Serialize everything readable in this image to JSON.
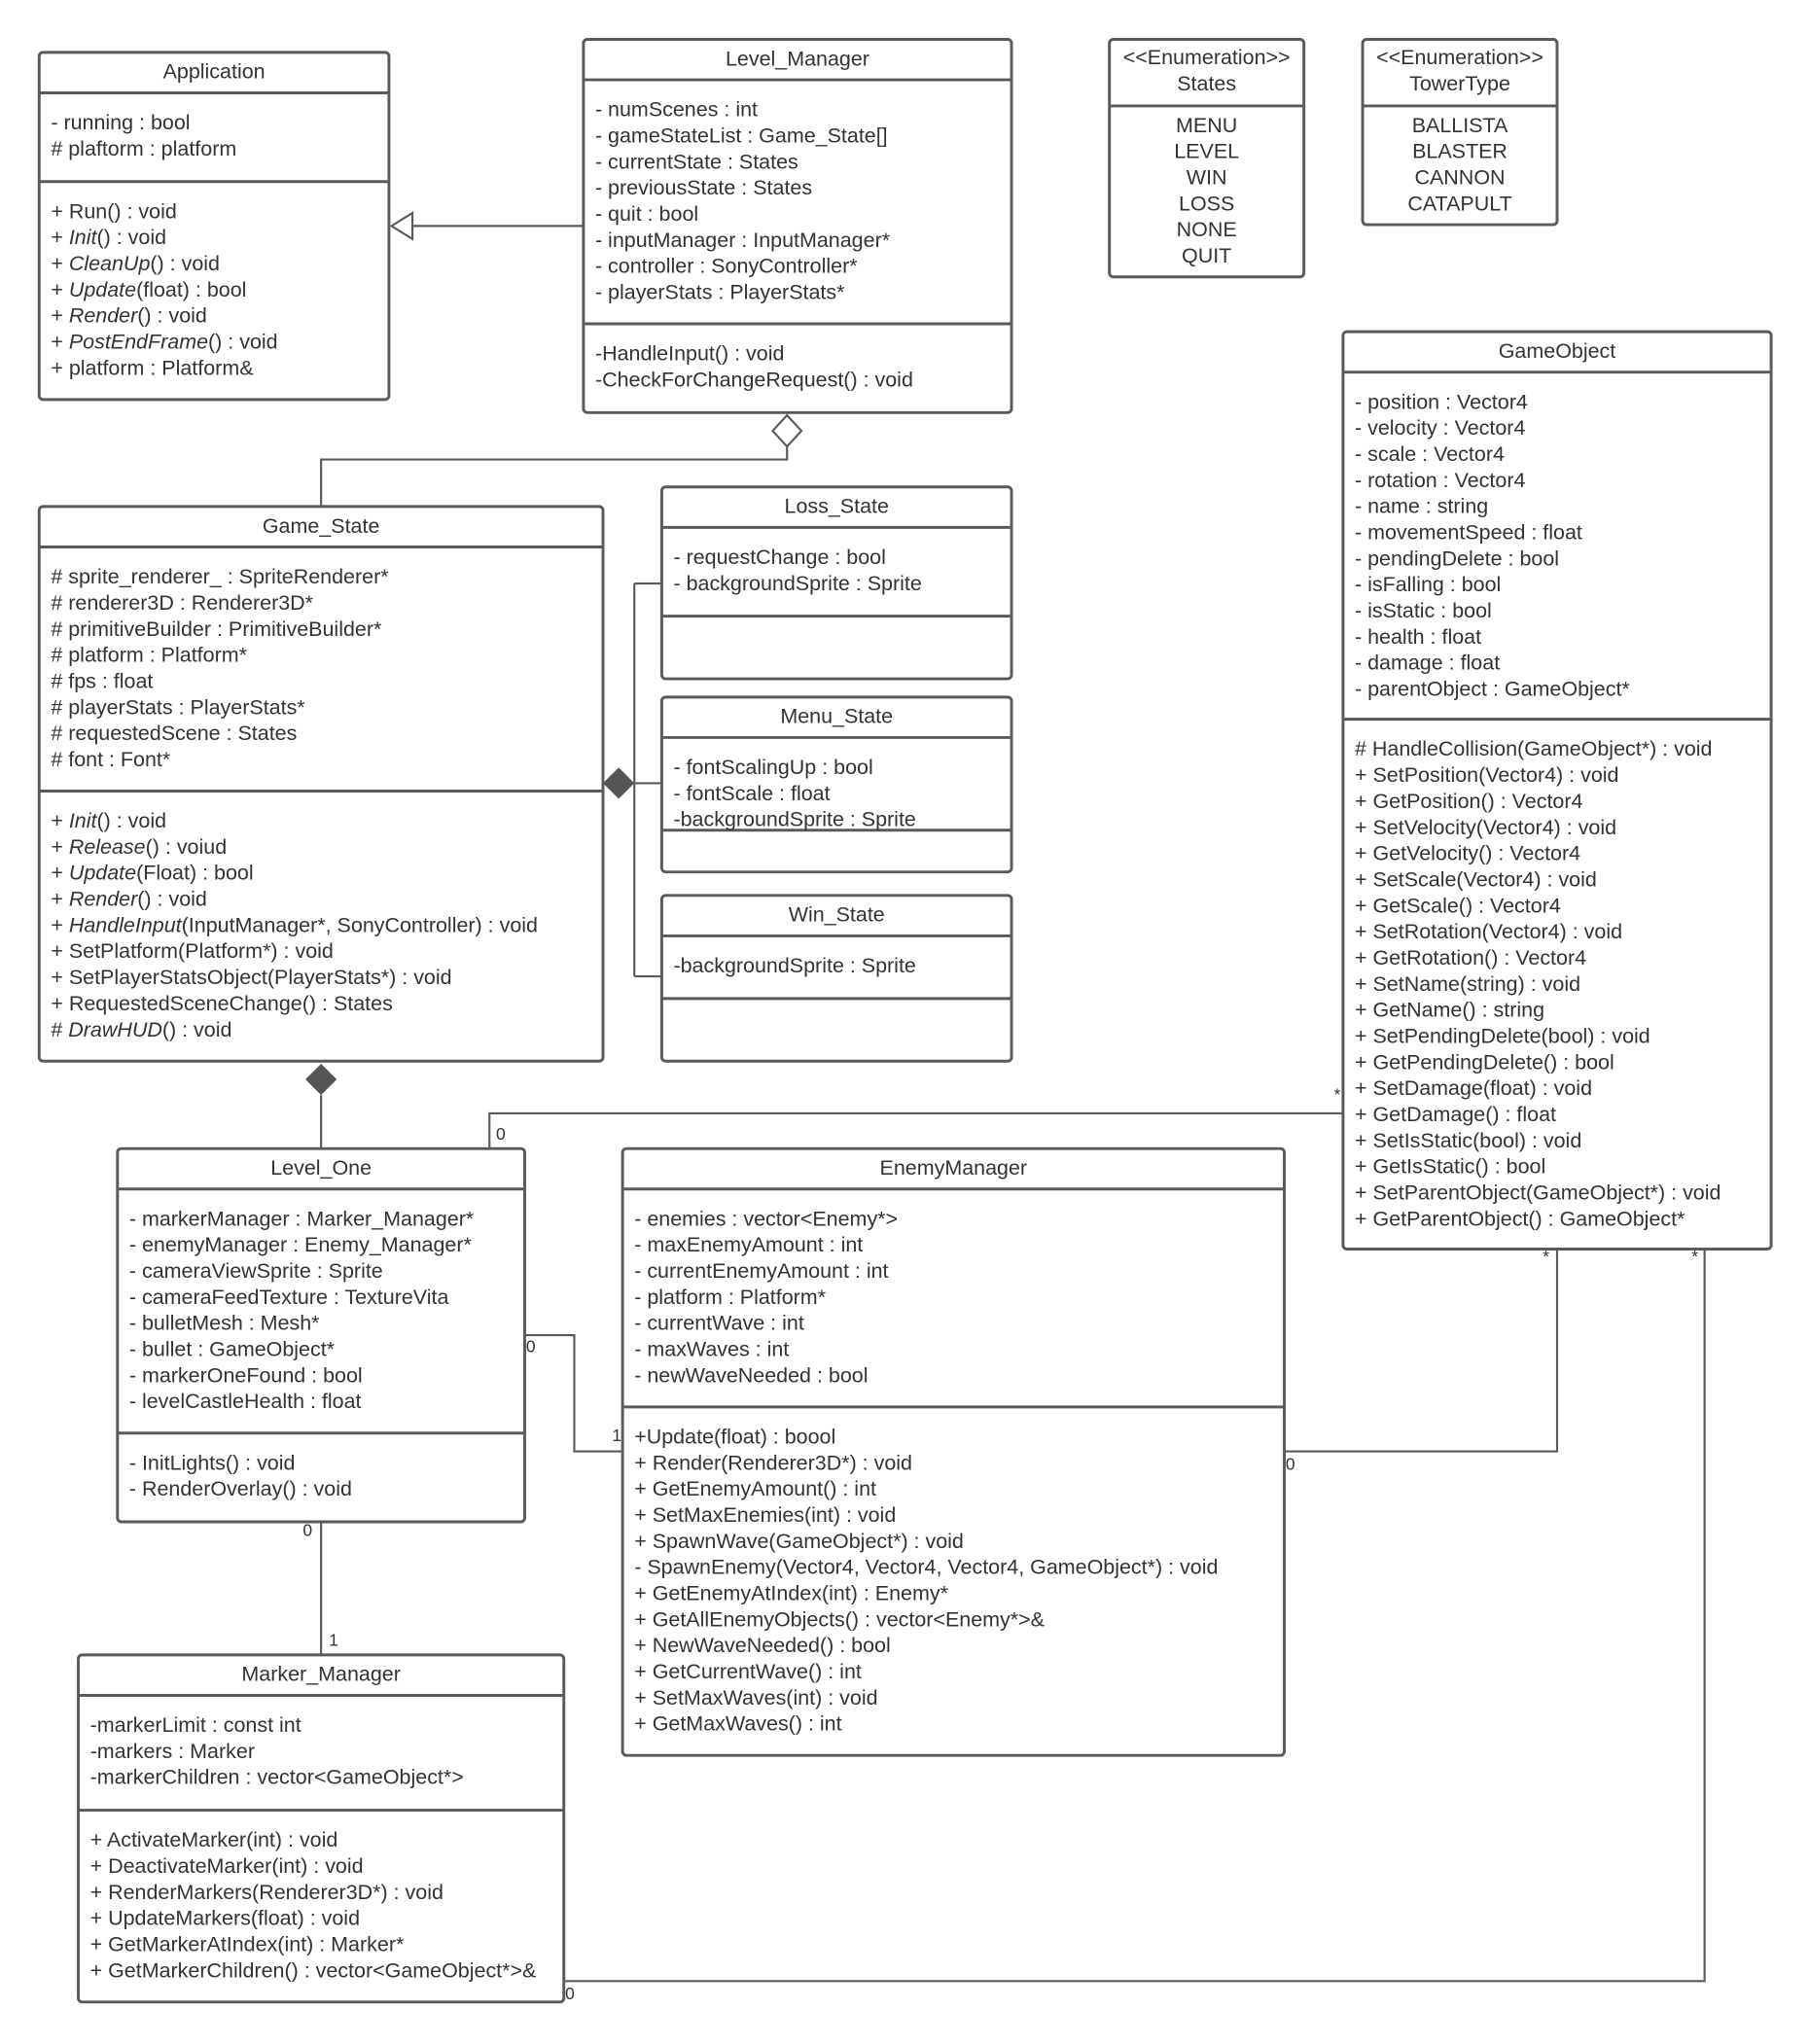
{
  "classes": [
    {
      "id": "application",
      "title": "Application",
      "attributes": [
        "- running : bool",
        "# plaftorm : platform"
      ],
      "methods": [
        {
          "text": "+ Run() : void"
        },
        {
          "text": "+ Init() : void",
          "abstract": true
        },
        {
          "text": "+ CleanUp() : void",
          "abstract": true
        },
        {
          "text": "+ Update(float) : bool",
          "abstract": true
        },
        {
          "text": "+ Render() : void",
          "abstract": true
        },
        {
          "text": "+ PostEndFrame() : void",
          "abstract": true
        },
        {
          "text": "+ platform : Platform&"
        }
      ]
    },
    {
      "id": "level-manager",
      "title": "Level_Manager",
      "attributes": [
        "- numScenes : int",
        "- gameStateList : Game_State[]",
        "- currentState : States",
        "- previousState : States",
        "- quit : bool",
        "- inputManager : InputManager*",
        "- controller : SonyController*",
        "- playerStats : PlayerStats*"
      ],
      "methods": [
        {
          "text": "-HandleInput() : void"
        },
        {
          "text": "-CheckForChangeRequest() : void"
        }
      ]
    },
    {
      "id": "states-enum",
      "title": "<<Enumeration>>",
      "subtitle": "States",
      "enum": true,
      "attributes": [
        "MENU",
        "LEVEL",
        "WIN",
        "LOSS",
        "NONE",
        "QUIT"
      ]
    },
    {
      "id": "towertype-enum",
      "title": "<<Enumeration>>",
      "subtitle": "TowerType",
      "enum": true,
      "attributes": [
        "BALLISTA",
        "BLASTER",
        "CANNON",
        "CATAPULT"
      ]
    },
    {
      "id": "gameobject",
      "title": "GameObject",
      "attributes": [
        "- position : Vector4",
        "- velocity : Vector4",
        "- scale : Vector4",
        "- rotation : Vector4",
        "- name : string",
        "- movementSpeed : float",
        "- pendingDelete : bool",
        "- isFalling : bool",
        "- isStatic : bool",
        "- health : float",
        "- damage : float",
        "- parentObject : GameObject*"
      ],
      "methods": [
        {
          "text": "# HandleCollision(GameObject*) : void"
        },
        {
          "text": "+ SetPosition(Vector4) : void"
        },
        {
          "text": "+ GetPosition() : Vector4"
        },
        {
          "text": "+ SetVelocity(Vector4) : void"
        },
        {
          "text": "+ GetVelocity() : Vector4"
        },
        {
          "text": "+ SetScale(Vector4) : void"
        },
        {
          "text": "+ GetScale() : Vector4"
        },
        {
          "text": "+ SetRotation(Vector4) : void"
        },
        {
          "text": "+ GetRotation() : Vector4"
        },
        {
          "text": "+ SetName(string) : void"
        },
        {
          "text": "+ GetName() : string"
        },
        {
          "text": "+ SetPendingDelete(bool) : void"
        },
        {
          "text": "+ GetPendingDelete() : bool"
        },
        {
          "text": "+ SetDamage(float) : void"
        },
        {
          "text": "+ GetDamage() : float"
        },
        {
          "text": "+ SetIsStatic(bool) : void"
        },
        {
          "text": "+ GetIsStatic() : bool"
        },
        {
          "text": "+ SetParentObject(GameObject*) : void"
        },
        {
          "text": "+ GetParentObject() : GameObject*"
        }
      ]
    },
    {
      "id": "game-state",
      "title": "Game_State",
      "attributes": [
        "# sprite_renderer_ : SpriteRenderer*",
        "# renderer3D : Renderer3D*",
        "# primitiveBuilder : PrimitiveBuilder*",
        "# platform : Platform*",
        "# fps : float",
        "# playerStats : PlayerStats*",
        "# requestedScene : States",
        "# font : Font*"
      ],
      "methods": [
        {
          "text": "+ Init() : void",
          "abstract": true
        },
        {
          "text": "+ Release() : voiud",
          "abstract": true
        },
        {
          "text": "+ Update(Float) : bool",
          "abstract": true
        },
        {
          "text": "+ Render() : void",
          "abstract": true
        },
        {
          "text": "+ HandleInput(InputManager*, SonyController) : void",
          "abstract": true
        },
        {
          "text": "+ SetPlatform(Platform*) : void"
        },
        {
          "text": "+ SetPlayerStatsObject(PlayerStats*) : void"
        },
        {
          "text": "+ RequestedSceneChange() : States"
        },
        {
          "text": "# DrawHUD() : void",
          "abstract": true
        }
      ]
    },
    {
      "id": "loss-state",
      "title": "Loss_State",
      "attributes": [
        "- requestChange : bool",
        "- backgroundSprite : Sprite"
      ],
      "methods": []
    },
    {
      "id": "menu-state",
      "title": "Menu_State",
      "attributes": [
        "- fontScalingUp : bool",
        "- fontScale : float",
        "-backgroundSprite : Sprite"
      ],
      "methods": []
    },
    {
      "id": "win-state",
      "title": "Win_State",
      "attributes": [
        "-backgroundSprite : Sprite"
      ],
      "methods": []
    },
    {
      "id": "level-one",
      "title": "Level_One",
      "attributes": [
        "- markerManager : Marker_Manager*",
        "- enemyManager : Enemy_Manager*",
        "- cameraViewSprite : Sprite",
        "- cameraFeedTexture : TextureVita",
        "- bulletMesh : Mesh*",
        "- bullet : GameObject*",
        "- markerOneFound : bool",
        "- levelCastleHealth : float"
      ],
      "methods": [
        {
          "text": "- InitLights() : void"
        },
        {
          "text": "- RenderOverlay() : void"
        }
      ]
    },
    {
      "id": "enemy-manager",
      "title": "EnemyManager",
      "attributes": [
        "- enemies : vector<Enemy*>",
        "- maxEnemyAmount : int",
        "- currentEnemyAmount : int",
        "- platform : Platform*",
        "- currentWave : int",
        "- maxWaves : int",
        "- newWaveNeeded : bool"
      ],
      "methods": [
        {
          "text": "+Update(float) : boool"
        },
        {
          "text": "+ Render(Renderer3D*) : void"
        },
        {
          "text": "+ GetEnemyAmount() : int"
        },
        {
          "text": "+ SetMaxEnemies(int) : void"
        },
        {
          "text": "+ SpawnWave(GameObject*) : void"
        },
        {
          "text": "- SpawnEnemy(Vector4, Vector4, Vector4, GameObject*) : void"
        },
        {
          "text": "+ GetEnemyAtIndex(int) : Enemy*"
        },
        {
          "text": "+ GetAllEnemyObjects() : vector<Enemy*>&"
        },
        {
          "text": "+ NewWaveNeeded() : bool"
        },
        {
          "text": "+ GetCurrentWave() : int"
        },
        {
          "text": "+ SetMaxWaves(int) : void"
        },
        {
          "text": "+ GetMaxWaves() : int"
        }
      ]
    },
    {
      "id": "marker-manager",
      "title": "Marker_Manager",
      "attributes": [
        "-markerLimit : const int",
        "-markers : Marker",
        "-markerChildren : vector<GameObject*>"
      ],
      "methods": [
        {
          "text": "+ ActivateMarker(int) : void"
        },
        {
          "text": "+ DeactivateMarker(int) : void"
        },
        {
          "text": "+ RenderMarkers(Renderer3D*) : void"
        },
        {
          "text": "+ UpdateMarkers(float) : void"
        },
        {
          "text": "+ GetMarkerAtIndex(int) : Marker*"
        },
        {
          "text": "+ GetMarkerChildren() : vector<GameObject*>&"
        }
      ]
    }
  ],
  "relationships": [
    {
      "id": "level-manager-inherits-application",
      "type": "generalization"
    },
    {
      "id": "level-manager-aggregates-game-state",
      "type": "aggregation"
    },
    {
      "id": "game-state-composition-substates",
      "type": "composition"
    },
    {
      "id": "game-state-composition-level-one",
      "type": "composition"
    },
    {
      "id": "level-one-to-gameobject",
      "type": "association",
      "source_mult": "0",
      "target_mult": "*"
    },
    {
      "id": "level-one-to-enemy-manager",
      "type": "association",
      "source_mult": "0",
      "target_mult": "1"
    },
    {
      "id": "enemy-manager-to-gameobject",
      "type": "association",
      "source_mult": "0",
      "target_mult": "*"
    },
    {
      "id": "level-one-to-marker-manager",
      "type": "association",
      "source_mult": "0",
      "target_mult": "1"
    },
    {
      "id": "marker-manager-to-gameobject",
      "type": "association",
      "source_mult": "0",
      "target_mult": "*"
    }
  ]
}
